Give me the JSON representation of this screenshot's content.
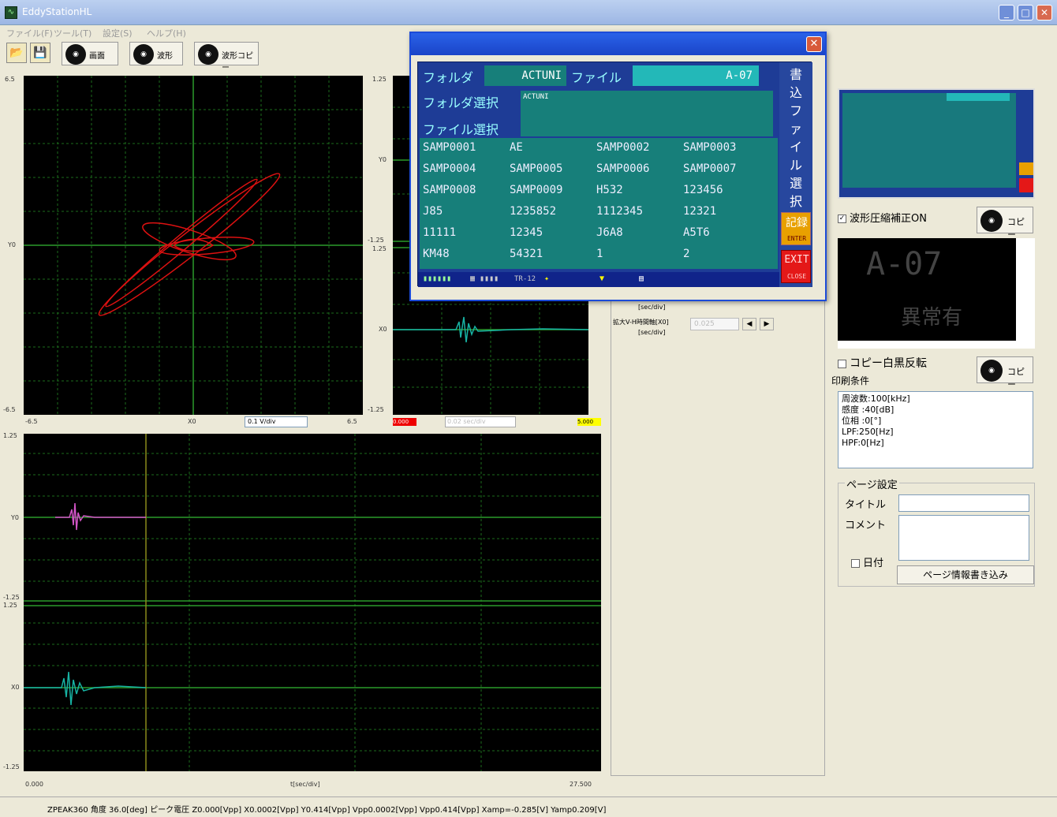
{
  "window": {
    "title": "EddyStationHL"
  },
  "menu": [
    "ファイル(F)",
    "ツール(T)",
    "設定(S)",
    "ヘルプ(H)"
  ],
  "toolbar": {
    "btn1_label": "画面",
    "btn2_label": "波形",
    "btn3_label": "波形コピー"
  },
  "lissajous": {
    "y_top": "6.5",
    "y_mid": "Y0",
    "y_bot": "-6.5",
    "x_left": "-6.5",
    "x_mid": "X0",
    "x_right": "6.5",
    "spin_value": "0.1 V/div"
  },
  "topright_plot": {
    "y_top": "1.25",
    "y_mid1": "Y0",
    "y_mid2a": "-1.25",
    "y_mid2b": "1.25",
    "y_mid3": "X0",
    "y_bot": "-1.25",
    "left_value": "0.000",
    "right_value": "5.000",
    "spin_value": "0.02 sec/div"
  },
  "bottom_plot": {
    "y1": "1.25",
    "y2": "Y0",
    "y3a": "-1.25",
    "y3b": "1.25",
    "y4": "X0",
    "y5": "-1.25",
    "x_left": "0.000",
    "x_mid": "t[sec/div]",
    "x_right": "27.500"
  },
  "dialog": {
    "folder_label": "フォルダ",
    "folder_value": "ACTUNI",
    "file_label": "ファイル",
    "file_value": "A-07",
    "folder_select_label": "フォルダ選択",
    "folder_select_value": "ACTUNI",
    "file_select_label": "ファイル選択",
    "files": [
      [
        "SAMP0001",
        "AE",
        "SAMP0002",
        "SAMP0003"
      ],
      [
        "SAMP0004",
        "SAMP0005",
        "SAMP0006",
        "SAMP0007"
      ],
      [
        "SAMP0008",
        "SAMP0009",
        "H532",
        "123456"
      ],
      [
        "J85",
        "1235852",
        "1112345",
        "12321"
      ],
      [
        "11111",
        "12345",
        "J6A8",
        "A5T6"
      ],
      [
        "KM48",
        "54321",
        "1",
        "2"
      ]
    ],
    "side_label": "書込ファイル選択",
    "record_label": "記録",
    "record_sub": "ENTER",
    "exit_label": "EXIT",
    "exit_sub": "CLOSE",
    "status_text": "TR-12"
  },
  "underlay": {
    "row1_label": "拡大V-H時間軸[X0]",
    "row1_unit": "[sec/div]",
    "row1_value": "0.025",
    "row0_unit": "[sec/div]"
  },
  "right": {
    "compress_label": "波形圧縮補正ON",
    "copy_label": "コピー",
    "display_line1": "A-07",
    "display_line2": "異常有",
    "invert_label": "コピー白黒反転",
    "print_label": "印刷条件",
    "conditions": [
      "周波数:100[kHz]",
      "感度 :40[dB]",
      "位相 :0[°]",
      "LPF:250[Hz]",
      "HPF:0[Hz]"
    ],
    "page_settings_label": "ページ設定",
    "title_label": "タイトル",
    "comment_label": "コメント",
    "date_label": "日付",
    "write_button": "ページ情報書き込み"
  },
  "statusbar": {
    "text": "ZPEAK360 角度 36.0[deg] ピーク電圧 Z0.000[Vpp] X0.0002[Vpp] Y0.414[Vpp] Vpp0.0002[Vpp] Vpp0.414[Vpp] Xamp=-0.285[V] Yamp0.209[V]"
  },
  "colors": {
    "lissajous_trace": "#dd1111",
    "signal_trace": "#17b3a3",
    "magenta_trace": "#d455c8",
    "grid": "#1d6b1d",
    "panel_blue": "#1e3c96",
    "panel_teal": "#177f7a"
  }
}
